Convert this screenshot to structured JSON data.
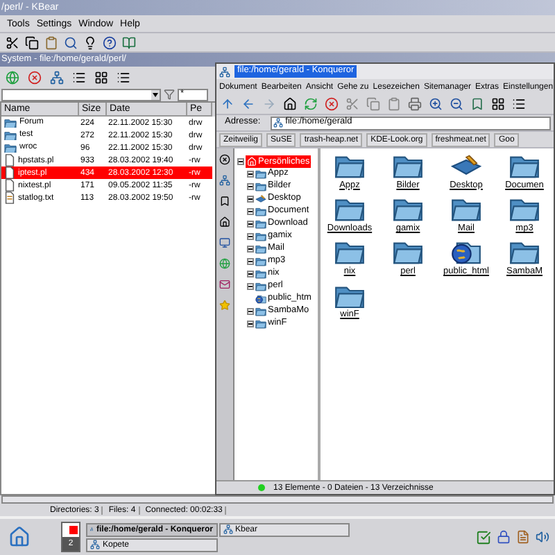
{
  "kbear": {
    "title": "/perl/ - KBear",
    "menu": [
      "Tools",
      "Settings",
      "Window",
      "Help"
    ],
    "panel_title": "System - file:/home/gerald/perl/",
    "filter": "*",
    "columns": [
      "Name",
      "Size",
      "Date",
      "Pe"
    ],
    "rows": [
      {
        "name": "Forum",
        "size": "224",
        "date": "22.11.2002 15:30",
        "perms": "drw",
        "kind": "folder",
        "selected": false
      },
      {
        "name": "test",
        "size": "272",
        "date": "22.11.2002 15:30",
        "perms": "drw",
        "kind": "folder",
        "selected": false
      },
      {
        "name": "wroc",
        "size": "96",
        "date": "22.11.2002 15:30",
        "perms": "drw",
        "kind": "folder",
        "selected": false
      },
      {
        "name": "hpstats.pl",
        "size": "933",
        "date": "28.03.2002 19:40",
        "perms": "-rw",
        "kind": "file",
        "selected": false
      },
      {
        "name": "iptest.pl",
        "size": "434",
        "date": "28.03.2002 12:30",
        "perms": "-rw",
        "kind": "file",
        "selected": true
      },
      {
        "name": "nixtest.pl",
        "size": "171",
        "date": "09.05.2002 11:35",
        "perms": "-rw",
        "kind": "file",
        "selected": false
      },
      {
        "name": "statlog.txt",
        "size": "113",
        "date": "28.03.2002 19:50",
        "perms": "-rw",
        "kind": "text",
        "selected": false
      }
    ],
    "status": [
      "Directories: 3",
      "Files: 4",
      "Connected: 00:02:33"
    ]
  },
  "konqueror": {
    "title": "file:/home/gerald - Konqueror",
    "menu": [
      "Dokument",
      "Bearbeiten",
      "Ansicht",
      "Gehe zu",
      "Lesezeichen",
      "Sitemanager",
      "Extras",
      "Einstellungen"
    ],
    "address_label": "Adresse:",
    "address": "file:/home/gerald",
    "bookmarks": [
      "Zeitweilig",
      "SuSE",
      "trash-heap.net",
      "KDE-Look.org",
      "freshmeat.net",
      "Goo"
    ],
    "tree": {
      "label": "Persönliches",
      "selected": true,
      "children": [
        {
          "label": "Appz",
          "kind": "folder",
          "expander": true,
          "selected": false
        },
        {
          "label": "Bilder",
          "kind": "folder",
          "expander": true,
          "selected": false
        },
        {
          "label": "Desktop",
          "kind": "desktop",
          "expander": true,
          "selected": false
        },
        {
          "label": "Document",
          "kind": "folder",
          "expander": true,
          "selected": false
        },
        {
          "label": "Download",
          "kind": "folder",
          "expander": true,
          "selected": false
        },
        {
          "label": "gamix",
          "kind": "folder",
          "expander": true,
          "selected": false
        },
        {
          "label": "Mail",
          "kind": "folder",
          "expander": true,
          "selected": false
        },
        {
          "label": "mp3",
          "kind": "folder",
          "expander": true,
          "selected": false
        },
        {
          "label": "nix",
          "kind": "folder",
          "expander": true,
          "selected": false
        },
        {
          "label": "perl",
          "kind": "folder",
          "expander": true,
          "selected": false
        },
        {
          "label": "public_htm",
          "kind": "web",
          "expander": false,
          "selected": false
        },
        {
          "label": "SambaMo",
          "kind": "folder",
          "expander": true,
          "selected": false
        },
        {
          "label": "winF",
          "kind": "folder",
          "expander": true,
          "selected": false
        }
      ]
    },
    "icons": [
      {
        "label": "Appz",
        "kind": "folder"
      },
      {
        "label": "Bilder",
        "kind": "folder"
      },
      {
        "label": "Desktop",
        "kind": "desktop"
      },
      {
        "label": "Documen",
        "kind": "folder"
      },
      {
        "label": "Downloads",
        "kind": "folder"
      },
      {
        "label": "gamix",
        "kind": "folder"
      },
      {
        "label": "Mail",
        "kind": "folder"
      },
      {
        "label": "mp3",
        "kind": "folder"
      },
      {
        "label": "nix",
        "kind": "folder"
      },
      {
        "label": "perl",
        "kind": "folder"
      },
      {
        "label": "public_html",
        "kind": "web"
      },
      {
        "label": "SambaM",
        "kind": "folder"
      },
      {
        "label": "winF",
        "kind": "folder"
      }
    ],
    "status": "13 Elemente - 0 Dateien - 13 Verzeichnisse"
  },
  "taskbar": {
    "pager_label": "2",
    "tasks": [
      {
        "label": "file:/home/gerald - Konqueror",
        "selected": true
      },
      {
        "label": "Kopete",
        "selected": false
      },
      {
        "label": "Kbear",
        "selected": false
      }
    ]
  }
}
